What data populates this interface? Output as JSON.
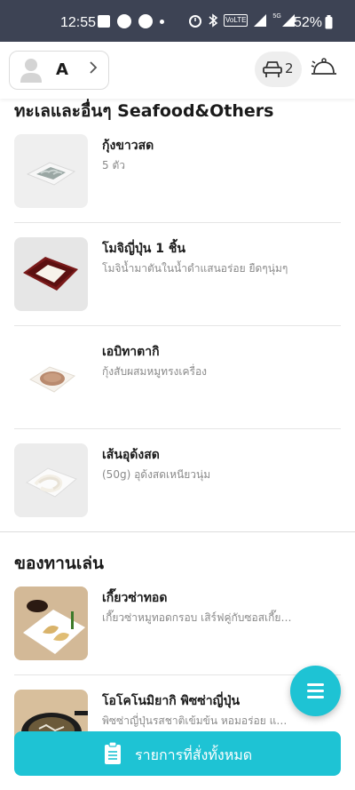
{
  "status_bar": {
    "time": "12:55",
    "network_label": "VoLTE",
    "signal_label": "5G",
    "battery": "52%"
  },
  "header": {
    "table_name": "A",
    "cart_count": "2"
  },
  "sections": [
    {
      "title": "ทะเลและอื่นๆ Seafood&Others",
      "items": [
        {
          "name": "กุ้งขาวสด",
          "desc": "5 ตัว"
        },
        {
          "name": "โมจิญี่ปุ่น 1 ชิ้น",
          "desc": "โมจิน้ำมาตันในน้ำดำแสนอร่อย ยืดๆนุ่มๆ"
        },
        {
          "name": "เอบิทาตากิ",
          "desc": "กุ้งสับผสมหมูทรงเครื่อง"
        },
        {
          "name": "เส้นอุด้งสด",
          "desc": "(50g) อุด้งสดเหนียวนุ่ม"
        }
      ]
    },
    {
      "title": "ของทานเล่น",
      "items": [
        {
          "name": "เกี๊ยวซ่าทอด",
          "desc": "เกี๊ยวซ่าหมูทอดกรอบ เสิร์ฟคู่กับซอสเกี๊ยวซ่า"
        },
        {
          "name": "โอโคโนมิยากิ พิซซ่าญี่ปุ่น",
          "desc": "พิซซ่าญี่ปุ่นรสชาติเข้มข้น หอมอร่อย และเหนียวนุ่ม"
        }
      ]
    }
  ],
  "orders_button_label": "รายการที่สั่งทั้งหมด",
  "colors": {
    "accent": "#1ec3d4",
    "status_bar": "#3d4354"
  },
  "icons": {
    "avatar": "user-avatar-icon",
    "chevron": "chevron-right-icon",
    "cart": "car-seat-icon",
    "bell": "service-bell-icon",
    "fab": "menu-icon",
    "orders": "clipboard-icon"
  }
}
